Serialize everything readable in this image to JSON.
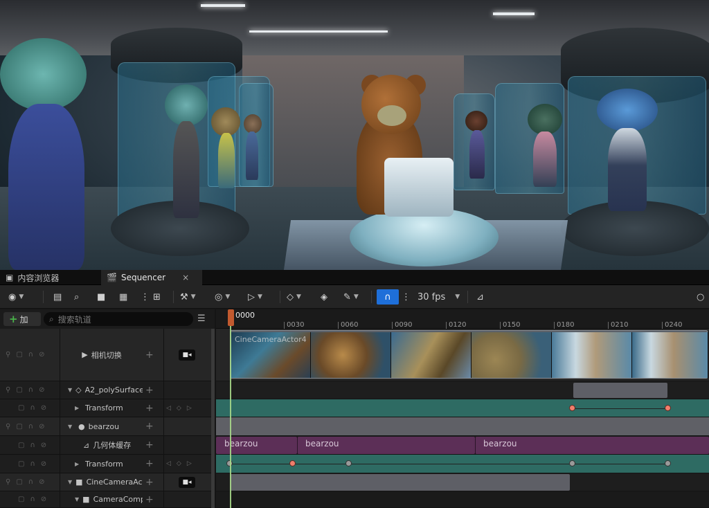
{
  "tabs": [
    {
      "label": "内容浏览器",
      "icon": "content-browser-icon",
      "active": false
    },
    {
      "label": "Sequencer",
      "icon": "sequencer-icon",
      "active": true,
      "close": "×"
    }
  ],
  "toolbar": {
    "fps": "30 fps",
    "accent": "#1e6fd9"
  },
  "outliner": {
    "add_label": "加",
    "search_placeholder": "搜索轨道"
  },
  "tracks": [
    {
      "name": "相机切换",
      "icon": "camera-cut-icon"
    },
    {
      "name": "A2_polySurface",
      "icon": "mesh-icon"
    },
    {
      "name": "Transform"
    },
    {
      "name": "bearzou",
      "icon": "actor-icon"
    },
    {
      "name": "几何体缓存",
      "icon": "geometry-cache-icon"
    },
    {
      "name": "Transform"
    },
    {
      "name": "CineCameraActor",
      "icon": "cine-camera-icon"
    },
    {
      "name": "CameraComp",
      "icon": "camera-component-icon"
    }
  ],
  "timeline": {
    "current_frame": "0000",
    "ticks": [
      "0030",
      "0060",
      "0090",
      "0120",
      "0150",
      "0180",
      "0210",
      "0240"
    ],
    "shot_label": "CineCameraActor4",
    "geometry_clips": [
      "bearzou",
      "bearzou",
      "bearzou"
    ],
    "track_color": "#2e6b63",
    "geo_color": "#5c2f57",
    "key_color": "#f07e6c"
  }
}
